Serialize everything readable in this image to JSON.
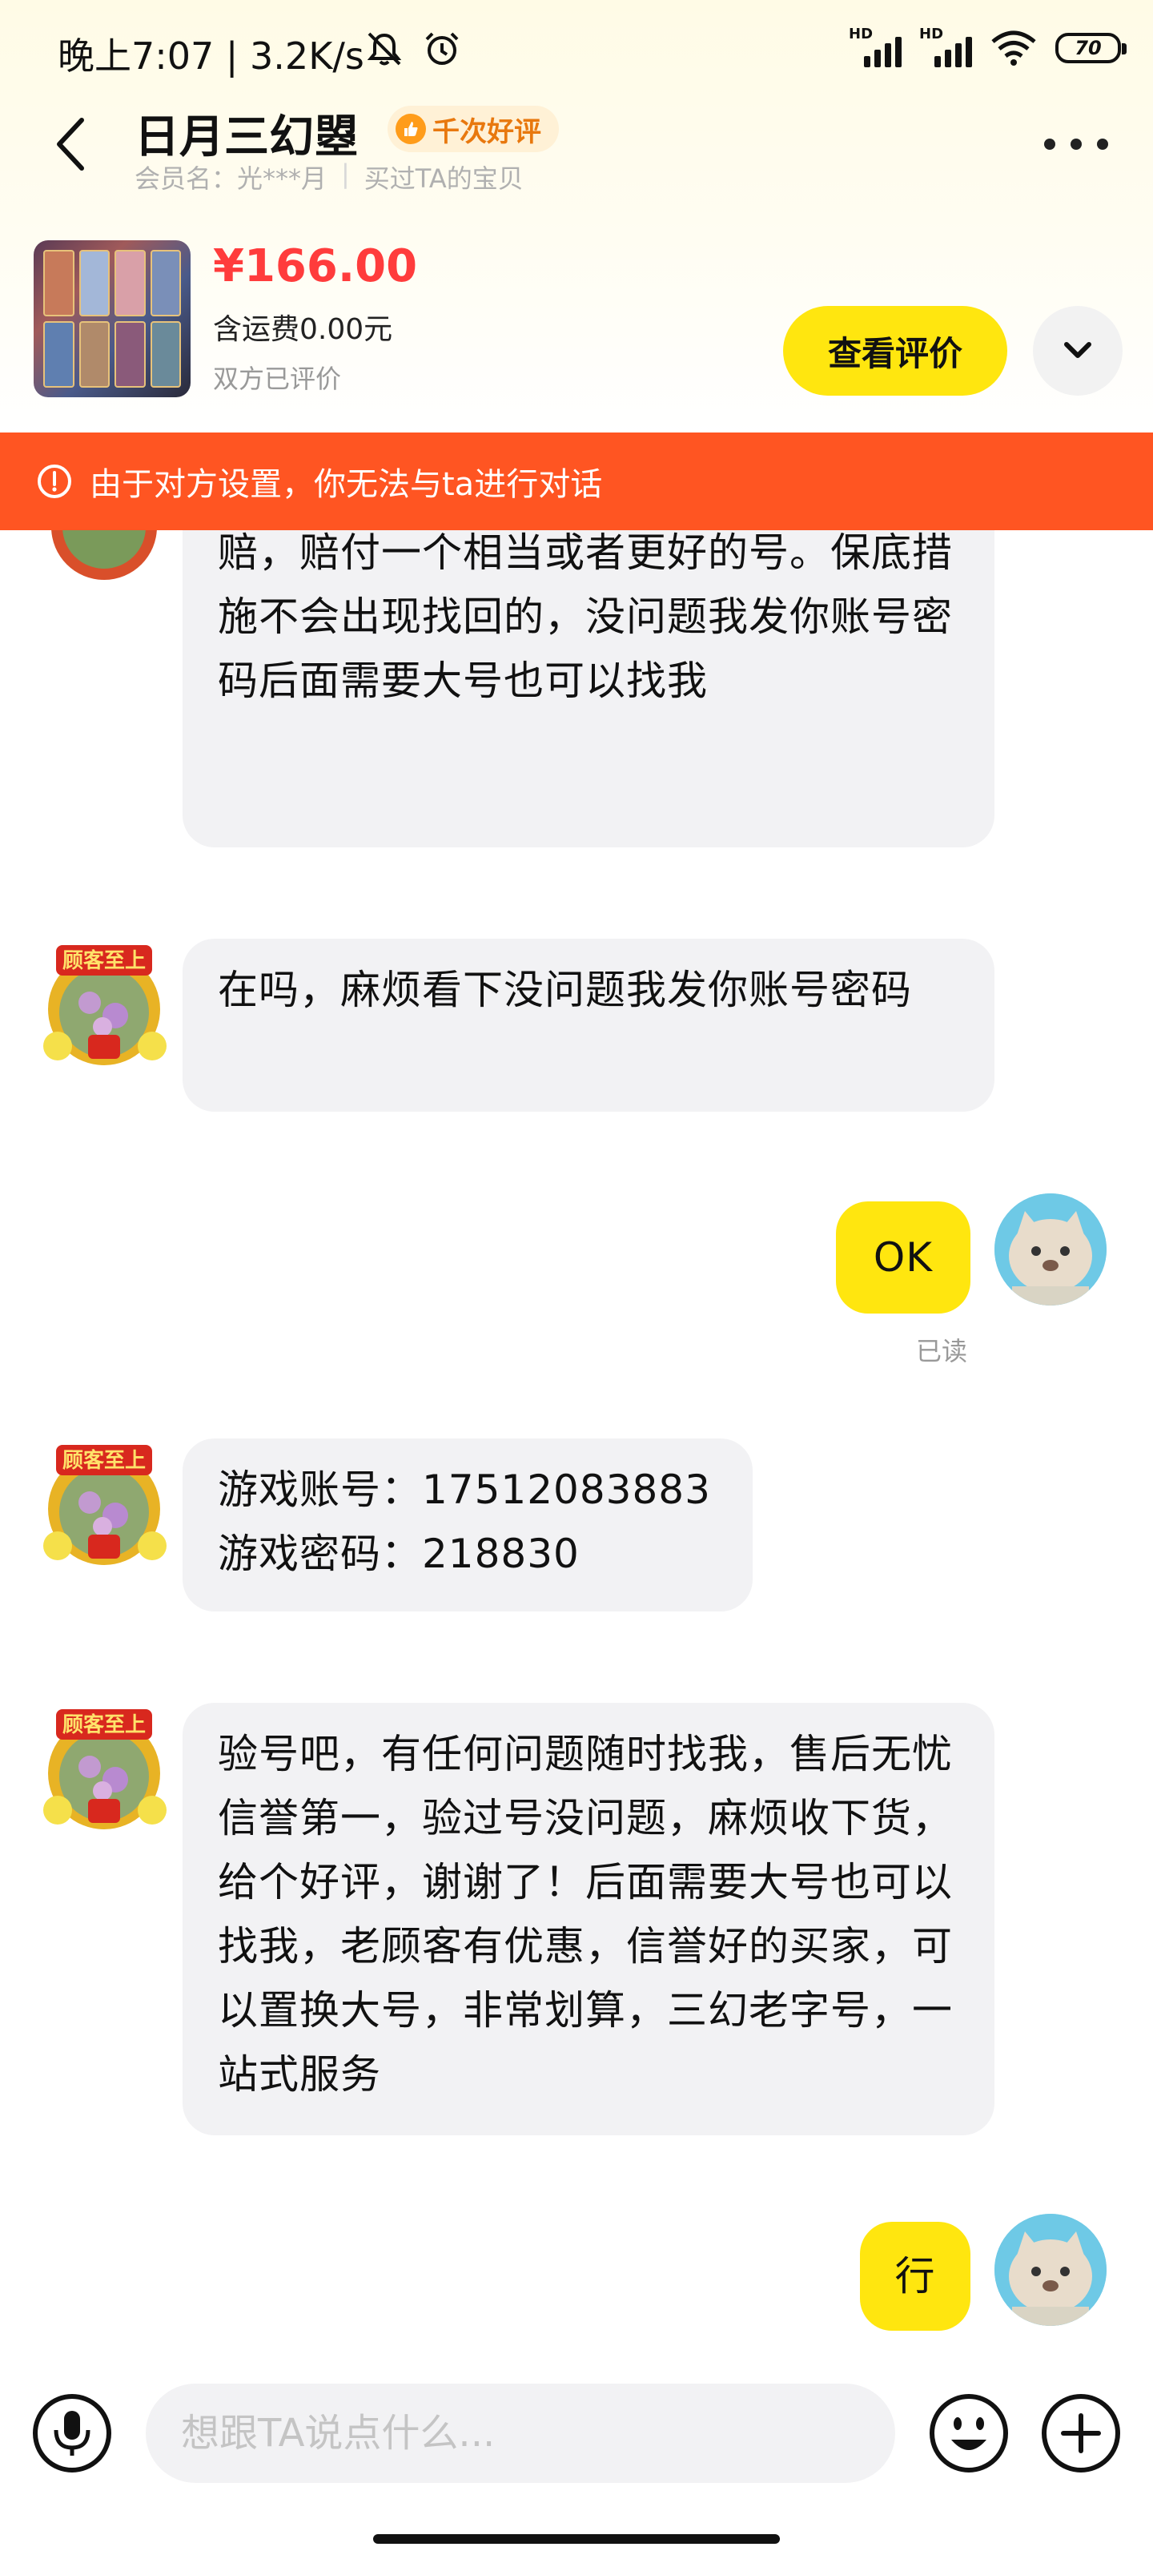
{
  "status_bar": {
    "time_speed": "晚上7:07 | 3.2K/s",
    "signal_labels": [
      "HD",
      "HD"
    ],
    "battery": "70"
  },
  "header": {
    "seller_name": "日月三幻曌",
    "rating_badge": "千次好评",
    "member_label": "会员名：光***月",
    "purchase_note": "买过TA的宝贝"
  },
  "product": {
    "price": "¥166.00",
    "shipping": "含运费0.00元",
    "review_status": "双方已评价",
    "view_reviews_label": "查看评价"
  },
  "notice": {
    "text": "由于对方设置，你无法与ta进行对话"
  },
  "messages": [
    {
      "from": "seller",
      "text": "货后不能退款，有问题随时找我，找回包赔，赔付一个相当或者更好的号。保底措施不会出现找回的，没问题我发你账号密码后面需要大号也可以找我"
    },
    {
      "from": "seller",
      "text": "在吗，麻烦看下没问题我发你账号密码"
    },
    {
      "from": "user",
      "text": "OK",
      "status": "已读"
    },
    {
      "from": "seller",
      "text": "游戏账号：17512083883\n游戏密码：218830"
    },
    {
      "from": "seller",
      "text": "验号吧，有任何问题随时找我，售后无忧信誉第一，验过号没问题，麻烦收下货，给个好评，谢谢了！后面需要大号也可以找我，老顾客有优惠，信誉好的买家，可以置换大号，非常划算，三幻老字号，一站式服务"
    },
    {
      "from": "user",
      "text": "行"
    }
  ],
  "seller_avatar_text": "顾客至上",
  "input": {
    "placeholder": "想跟TA说点什么..."
  },
  "colors": {
    "accent_yellow": "#ffe60f",
    "price_red": "#ff3c3c",
    "notice_orange": "#ff5522"
  },
  "icons": [
    "back-arrow-icon",
    "more-icon",
    "alert-icon",
    "chevron-down-icon",
    "microphone-icon",
    "emoji-icon",
    "plus-icon",
    "mute-icon",
    "alarm-icon",
    "wifi-icon"
  ]
}
